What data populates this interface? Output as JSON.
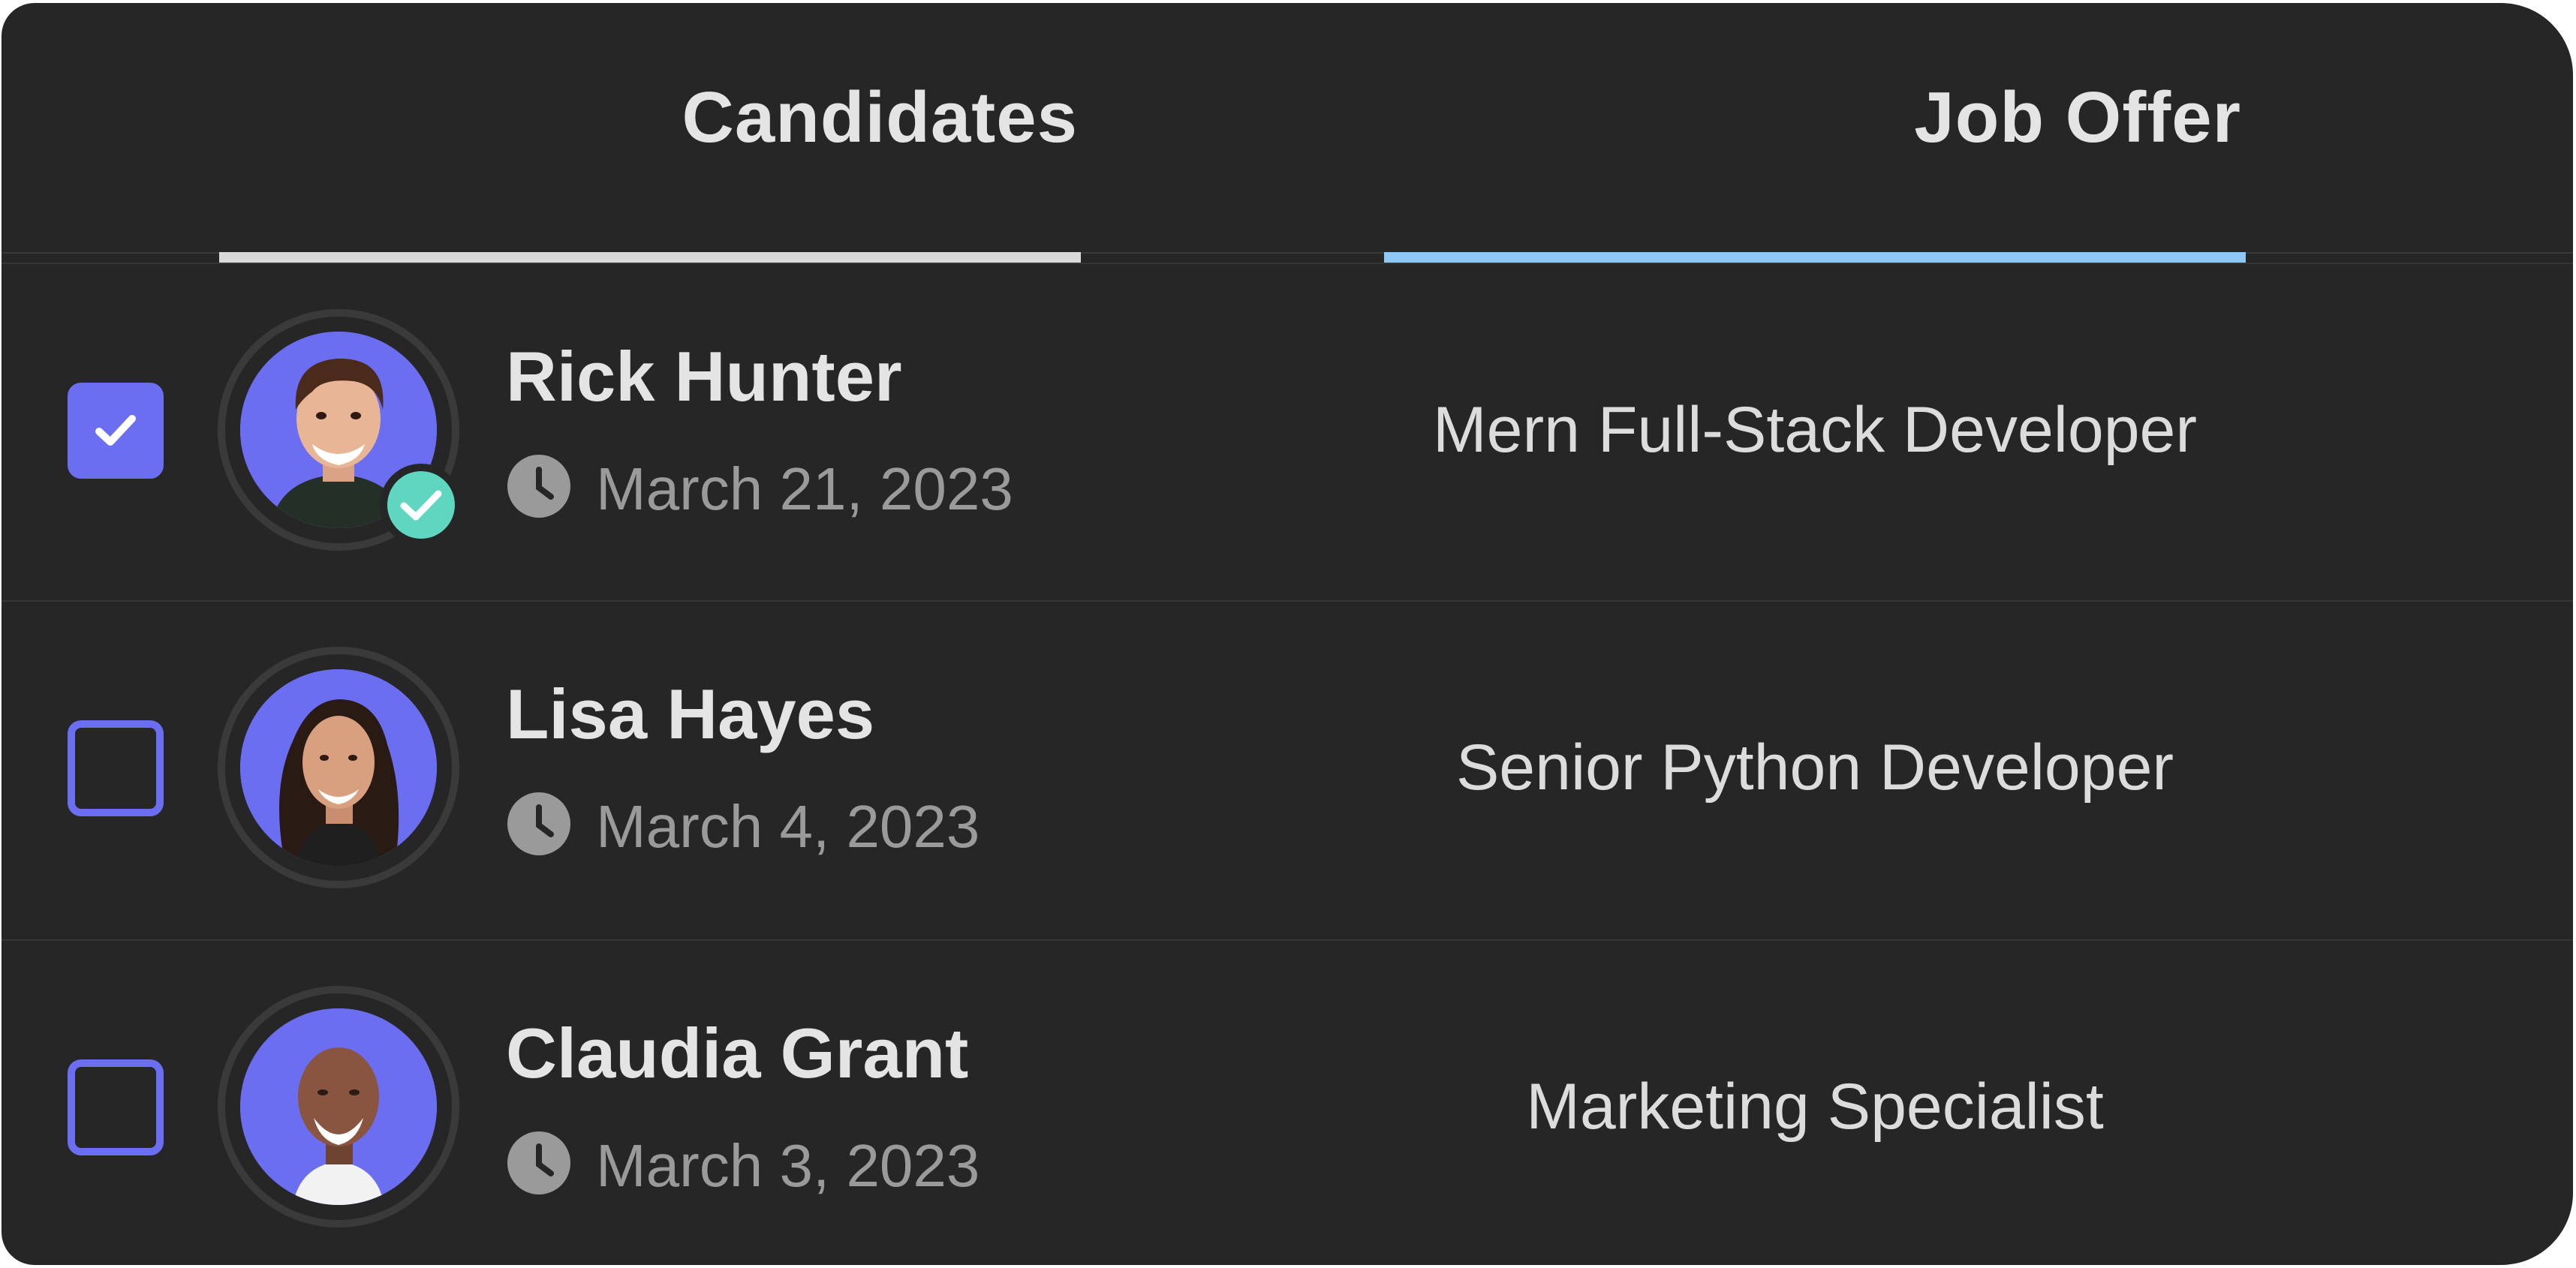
{
  "tabs": {
    "candidates_label": "Candidates",
    "job_offer_label": "Job Offer"
  },
  "rows": [
    {
      "name": "Rick Hunter",
      "date": "March 21, 2023",
      "job": "Mern Full-Stack Developer",
      "selected": true,
      "verified": true
    },
    {
      "name": "Lisa Hayes",
      "date": "March 4, 2023",
      "job": "Senior Python Developer",
      "selected": false,
      "verified": false
    },
    {
      "name": "Claudia Grant",
      "date": "March 3, 2023",
      "job": "Marketing Specialist",
      "selected": false,
      "verified": false
    }
  ],
  "icons": {
    "checkbox": "checkmark-icon",
    "verified": "verified-check-icon",
    "date": "clock-icon"
  },
  "colors": {
    "background": "#262626",
    "accent": "#6b6ef0",
    "verified": "#5fd6c0",
    "job_offer_underline": "#8fc8f5",
    "candidates_underline": "#d9d9d9"
  }
}
